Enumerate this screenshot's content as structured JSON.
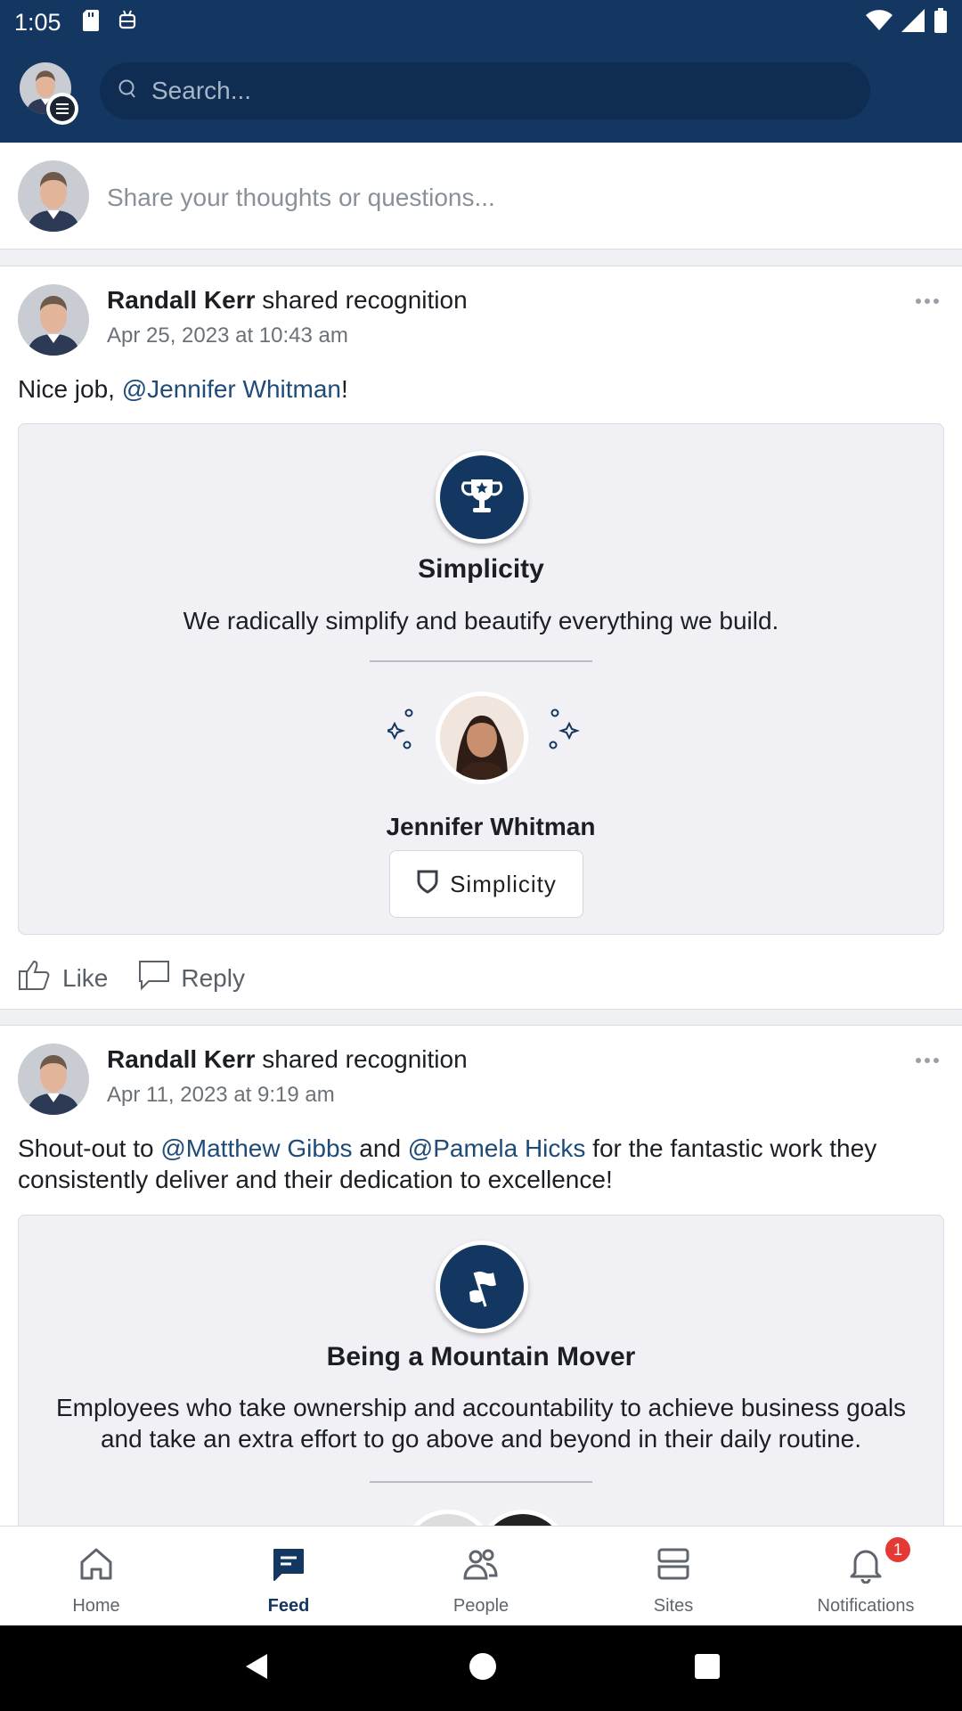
{
  "status_bar": {
    "time": "1:05"
  },
  "search": {
    "placeholder": "Search..."
  },
  "composer": {
    "placeholder": "Share your thoughts or questions..."
  },
  "posts": [
    {
      "author": "Randall Kerr",
      "action": "shared recognition",
      "date": "Apr 25, 2023 at 10:43 am",
      "body_prefix": "Nice job, ",
      "mention1": "@Jennifer Whitman",
      "body_suffix": "!",
      "award": {
        "icon": "trophy-icon",
        "title": "Simplicity",
        "description": "We radically simplify and beautify everything we build."
      },
      "recipient": "Jennifer Whitman",
      "chip": "Simplicity",
      "like": "Like",
      "reply": "Reply"
    },
    {
      "author": "Randall Kerr",
      "action": "shared recognition",
      "date": "Apr 11, 2023 at 9:19 am",
      "body_a": "Shout-out to ",
      "mention1": "@Matthew Gibbs",
      "body_b": " and ",
      "mention2": "@Pamela Hicks",
      "body_c": " for the fantastic work they consistently deliver and their dedication to excellence!",
      "award": {
        "icon": "flag-hand-icon",
        "title": "Being a Mountain Mover",
        "description": "Employees who take ownership and accountability to achieve business goals and take an extra effort to go above and beyond in their daily routine."
      }
    }
  ],
  "nav": [
    {
      "label": "Home",
      "icon": "home-icon"
    },
    {
      "label": "Feed",
      "icon": "feed-icon",
      "active": true
    },
    {
      "label": "People",
      "icon": "people-icon"
    },
    {
      "label": "Sites",
      "icon": "sites-icon"
    },
    {
      "label": "Notifications",
      "icon": "bell-icon",
      "badge": "1"
    }
  ],
  "colors": {
    "brand": "#143762",
    "mention": "#1e4b78",
    "badge": "#e53935"
  }
}
